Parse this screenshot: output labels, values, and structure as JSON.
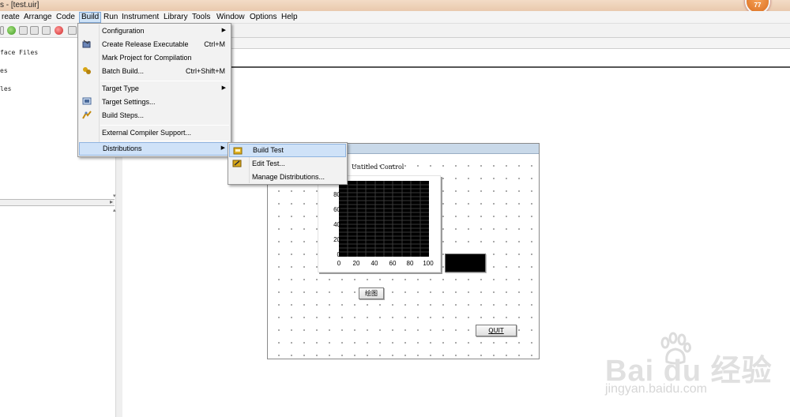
{
  "window": {
    "title": "s - [test.uir]",
    "badge": "77"
  },
  "menubar": {
    "items": [
      {
        "label": "reate"
      },
      {
        "label": "Arrange"
      },
      {
        "label": "Code"
      },
      {
        "label": "Build"
      },
      {
        "label": "Run"
      },
      {
        "label": "Instrument"
      },
      {
        "label": "Library"
      },
      {
        "label": "Tools"
      },
      {
        "label": "Window"
      },
      {
        "label": "Options"
      },
      {
        "label": "Help"
      }
    ]
  },
  "left_panel": {
    "lines": [
      "face Files",
      "es",
      "les"
    ]
  },
  "build_menu": {
    "items": [
      {
        "label": "Configuration",
        "shortcut": "",
        "submenu": true
      },
      {
        "label": "Create Release Executable",
        "shortcut": "Ctrl+M"
      },
      {
        "label": "Mark Project for Compilation",
        "shortcut": ""
      },
      {
        "label": "Batch Build...",
        "shortcut": "Ctrl+Shift+M"
      },
      {
        "label": "Target Type",
        "shortcut": "",
        "submenu": true
      },
      {
        "label": "Target Settings...",
        "shortcut": ""
      },
      {
        "label": "Build Steps...",
        "shortcut": ""
      },
      {
        "label": "External Compiler Support...",
        "shortcut": ""
      },
      {
        "label": "Distributions",
        "shortcut": "",
        "submenu": true
      }
    ]
  },
  "distributions_menu": {
    "items": [
      {
        "label": "Build Test"
      },
      {
        "label": "Edit Test..."
      },
      {
        "label": "Manage Distributions..."
      }
    ]
  },
  "uir": {
    "graph_label": "Untitled Control",
    "y_ticks": [
      "80",
      "60",
      "40",
      "20",
      "0"
    ],
    "x_ticks": [
      "0",
      "20",
      "40",
      "60",
      "80",
      "100"
    ],
    "draw_button": "绘图",
    "quit_button": "QUIT"
  },
  "watermark": {
    "brand": "Bai du 经验",
    "url": "jingyan.baidu.com"
  }
}
